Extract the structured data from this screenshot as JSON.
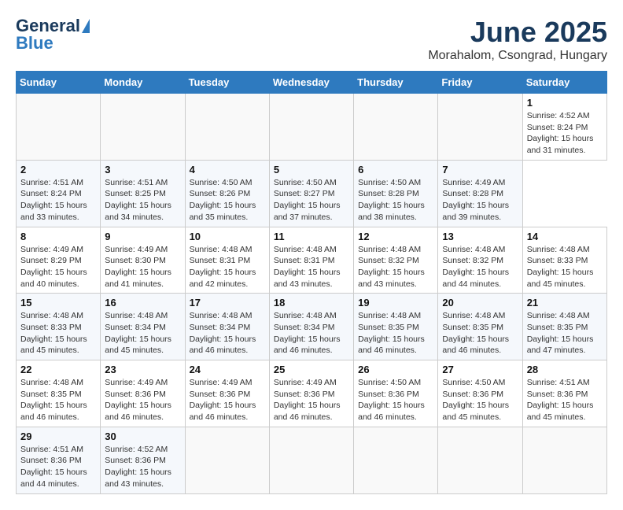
{
  "header": {
    "logo_general": "General",
    "logo_blue": "Blue",
    "month_title": "June 2025",
    "location": "Morahalom, Csongrad, Hungary"
  },
  "calendar": {
    "headers": [
      "Sunday",
      "Monday",
      "Tuesday",
      "Wednesday",
      "Thursday",
      "Friday",
      "Saturday"
    ],
    "weeks": [
      [
        {
          "day": "",
          "info": ""
        },
        {
          "day": "",
          "info": ""
        },
        {
          "day": "",
          "info": ""
        },
        {
          "day": "",
          "info": ""
        },
        {
          "day": "",
          "info": ""
        },
        {
          "day": "",
          "info": ""
        },
        {
          "day": "1",
          "info": "Sunrise: 4:52 AM\nSunset: 8:24 PM\nDaylight: 15 hours\nand 31 minutes."
        }
      ],
      [
        {
          "day": "2",
          "info": "Sunrise: 4:51 AM\nSunset: 8:24 PM\nDaylight: 15 hours\nand 33 minutes."
        },
        {
          "day": "3",
          "info": "Sunrise: 4:51 AM\nSunset: 8:25 PM\nDaylight: 15 hours\nand 34 minutes."
        },
        {
          "day": "4",
          "info": "Sunrise: 4:50 AM\nSunset: 8:26 PM\nDaylight: 15 hours\nand 35 minutes."
        },
        {
          "day": "5",
          "info": "Sunrise: 4:50 AM\nSunset: 8:27 PM\nDaylight: 15 hours\nand 37 minutes."
        },
        {
          "day": "6",
          "info": "Sunrise: 4:50 AM\nSunset: 8:28 PM\nDaylight: 15 hours\nand 38 minutes."
        },
        {
          "day": "7",
          "info": "Sunrise: 4:49 AM\nSunset: 8:28 PM\nDaylight: 15 hours\nand 39 minutes."
        }
      ],
      [
        {
          "day": "8",
          "info": "Sunrise: 4:49 AM\nSunset: 8:29 PM\nDaylight: 15 hours\nand 40 minutes."
        },
        {
          "day": "9",
          "info": "Sunrise: 4:49 AM\nSunset: 8:30 PM\nDaylight: 15 hours\nand 41 minutes."
        },
        {
          "day": "10",
          "info": "Sunrise: 4:48 AM\nSunset: 8:31 PM\nDaylight: 15 hours\nand 42 minutes."
        },
        {
          "day": "11",
          "info": "Sunrise: 4:48 AM\nSunset: 8:31 PM\nDaylight: 15 hours\nand 43 minutes."
        },
        {
          "day": "12",
          "info": "Sunrise: 4:48 AM\nSunset: 8:32 PM\nDaylight: 15 hours\nand 43 minutes."
        },
        {
          "day": "13",
          "info": "Sunrise: 4:48 AM\nSunset: 8:32 PM\nDaylight: 15 hours\nand 44 minutes."
        },
        {
          "day": "14",
          "info": "Sunrise: 4:48 AM\nSunset: 8:33 PM\nDaylight: 15 hours\nand 45 minutes."
        }
      ],
      [
        {
          "day": "15",
          "info": "Sunrise: 4:48 AM\nSunset: 8:33 PM\nDaylight: 15 hours\nand 45 minutes."
        },
        {
          "day": "16",
          "info": "Sunrise: 4:48 AM\nSunset: 8:34 PM\nDaylight: 15 hours\nand 45 minutes."
        },
        {
          "day": "17",
          "info": "Sunrise: 4:48 AM\nSunset: 8:34 PM\nDaylight: 15 hours\nand 46 minutes."
        },
        {
          "day": "18",
          "info": "Sunrise: 4:48 AM\nSunset: 8:34 PM\nDaylight: 15 hours\nand 46 minutes."
        },
        {
          "day": "19",
          "info": "Sunrise: 4:48 AM\nSunset: 8:35 PM\nDaylight: 15 hours\nand 46 minutes."
        },
        {
          "day": "20",
          "info": "Sunrise: 4:48 AM\nSunset: 8:35 PM\nDaylight: 15 hours\nand 46 minutes."
        },
        {
          "day": "21",
          "info": "Sunrise: 4:48 AM\nSunset: 8:35 PM\nDaylight: 15 hours\nand 47 minutes."
        }
      ],
      [
        {
          "day": "22",
          "info": "Sunrise: 4:48 AM\nSunset: 8:35 PM\nDaylight: 15 hours\nand 46 minutes."
        },
        {
          "day": "23",
          "info": "Sunrise: 4:49 AM\nSunset: 8:36 PM\nDaylight: 15 hours\nand 46 minutes."
        },
        {
          "day": "24",
          "info": "Sunrise: 4:49 AM\nSunset: 8:36 PM\nDaylight: 15 hours\nand 46 minutes."
        },
        {
          "day": "25",
          "info": "Sunrise: 4:49 AM\nSunset: 8:36 PM\nDaylight: 15 hours\nand 46 minutes."
        },
        {
          "day": "26",
          "info": "Sunrise: 4:50 AM\nSunset: 8:36 PM\nDaylight: 15 hours\nand 46 minutes."
        },
        {
          "day": "27",
          "info": "Sunrise: 4:50 AM\nSunset: 8:36 PM\nDaylight: 15 hours\nand 45 minutes."
        },
        {
          "day": "28",
          "info": "Sunrise: 4:51 AM\nSunset: 8:36 PM\nDaylight: 15 hours\nand 45 minutes."
        }
      ],
      [
        {
          "day": "29",
          "info": "Sunrise: 4:51 AM\nSunset: 8:36 PM\nDaylight: 15 hours\nand 44 minutes."
        },
        {
          "day": "30",
          "info": "Sunrise: 4:52 AM\nSunset: 8:36 PM\nDaylight: 15 hours\nand 43 minutes."
        },
        {
          "day": "",
          "info": ""
        },
        {
          "day": "",
          "info": ""
        },
        {
          "day": "",
          "info": ""
        },
        {
          "day": "",
          "info": ""
        },
        {
          "day": "",
          "info": ""
        }
      ]
    ]
  }
}
